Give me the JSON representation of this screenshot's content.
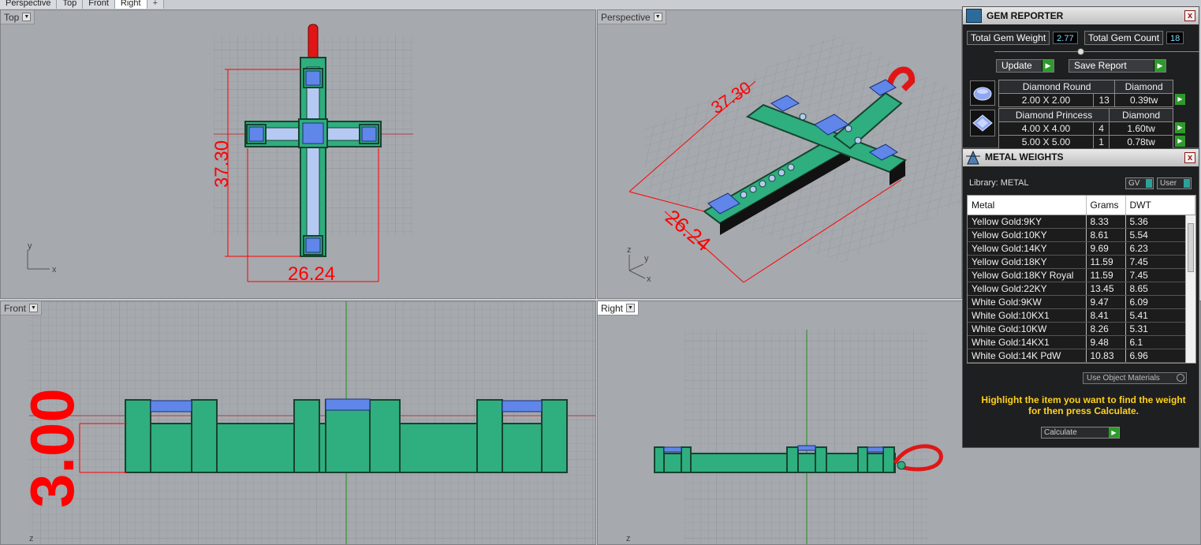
{
  "tabs": [
    {
      "label": "Perspective"
    },
    {
      "label": "Top"
    },
    {
      "label": "Front"
    },
    {
      "label": "Right"
    },
    {
      "label": "+"
    }
  ],
  "viewports": {
    "top": {
      "label": "Top",
      "axis_y": "y",
      "axis_x": "x",
      "dim_height": "37.30",
      "dim_width": "26.24"
    },
    "perspective": {
      "label": "Perspective",
      "axis_z": "z",
      "axis_y": "y",
      "axis_x": "x",
      "dim_height": "37.30",
      "dim_width": "26.24"
    },
    "front": {
      "label": "Front",
      "axis_z": "z",
      "dim_thickness": "3.00"
    },
    "right": {
      "label": "Right",
      "axis_z": "z"
    }
  },
  "gem_reporter": {
    "title": "GEM REPORTER",
    "close": "x",
    "total_weight_label": "Total Gem Weight",
    "total_weight_value": "2.77",
    "total_count_label": "Total Gem Count",
    "total_count_value": "18",
    "update_label": "Update",
    "save_label": "Save Report",
    "go_glyph": "▶",
    "groups": [
      {
        "icon": "round-diamond-icon",
        "name": "Diamond Round",
        "material": "Diamond",
        "rows": [
          {
            "size": "2.00 X 2.00",
            "count": "13",
            "weight": "0.39tw"
          }
        ]
      },
      {
        "icon": "princess-diamond-icon",
        "name": "Diamond Princess",
        "material": "Diamond",
        "rows": [
          {
            "size": "4.00 X 4.00",
            "count": "4",
            "weight": "1.60tw"
          },
          {
            "size": "5.00 X 5.00",
            "count": "1",
            "weight": "0.78tw"
          }
        ]
      }
    ]
  },
  "metal_weights": {
    "title": "METAL WEIGHTS",
    "close": "x",
    "library_label": "Library: METAL",
    "toggle_gv": "GV",
    "toggle_user": "User",
    "columns": [
      "Metal",
      "Grams",
      "DWT"
    ],
    "rows": [
      [
        "Yellow Gold:9KY",
        "8.33",
        "5.36"
      ],
      [
        "Yellow Gold:10KY",
        "8.61",
        "5.54"
      ],
      [
        "Yellow Gold:14KY",
        "9.69",
        "6.23"
      ],
      [
        "Yellow Gold:18KY",
        "11.59",
        "7.45"
      ],
      [
        "Yellow Gold:18KY Royal",
        "11.59",
        "7.45"
      ],
      [
        "Yellow Gold:22KY",
        "13.45",
        "8.65"
      ],
      [
        "White Gold:9KW",
        "9.47",
        "6.09"
      ],
      [
        "White Gold:10KX1",
        "8.41",
        "5.41"
      ],
      [
        "White Gold:10KW",
        "8.26",
        "5.31"
      ],
      [
        "White Gold:14KX1",
        "9.48",
        "6.1"
      ],
      [
        "White Gold:14K PdW",
        "10.83",
        "6.96"
      ]
    ],
    "use_object_materials": "Use Object Materials",
    "hint": "Highlight the item you want to find the weight for then press Calculate.",
    "calculate": "Calculate"
  },
  "colors": {
    "metal_green": "#2fae7f",
    "stone_blue": "#5f86e8",
    "dimension_red": "#ff0000",
    "accent_yellow": "#ffd21a"
  }
}
